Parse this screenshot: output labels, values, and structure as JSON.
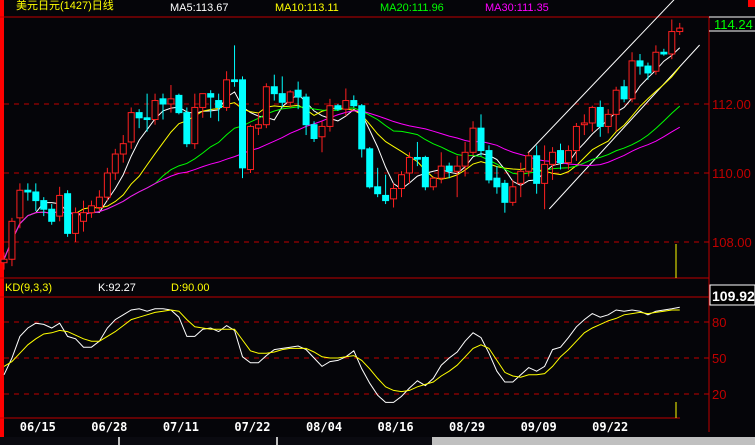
{
  "header": {
    "title": "美元日元(1427)日线",
    "ma5": "MA5:113.67",
    "ma10": "MA10:113.11",
    "ma20": "MA20:111.96",
    "ma30": "MA30:111.35"
  },
  "indicator": {
    "name": "KD(9,3,3)",
    "k": "K:92.27",
    "d": "D:90.00"
  },
  "right_axis": {
    "current_price": "114.24",
    "price_ticks": [
      "112.00",
      "110.00",
      "108.00"
    ],
    "cursor_value": "109.92",
    "kd_ticks": [
      "80",
      "50",
      "20"
    ]
  },
  "colors": {
    "up": "#ff2020",
    "down": "#00ffff",
    "ma5": "#ffffff",
    "ma10": "#ffff00",
    "ma20": "#00ff00",
    "ma30": "#ff00ff",
    "grid": "#c00000"
  },
  "chart_data": [
    {
      "type": "candlestick",
      "title": "美元日元(1427)日线",
      "x_tick_labels": [
        "06/15",
        "06/28",
        "07/11",
        "07/22",
        "08/04",
        "08/16",
        "08/29",
        "09/09",
        "09/22"
      ],
      "x_tick_index": [
        4,
        13,
        22,
        31,
        40,
        49,
        58,
        67,
        76
      ],
      "ylim": [
        107.0,
        114.9
      ],
      "y_ticks": [
        108,
        110,
        112
      ],
      "ohlc": [
        [
          107.4,
          107.7,
          107.2,
          107.5
        ],
        [
          107.5,
          108.7,
          107.3,
          108.6
        ],
        [
          108.7,
          109.7,
          108.4,
          109.5
        ],
        [
          109.5,
          109.7,
          109.2,
          109.45
        ],
        [
          109.45,
          109.7,
          108.9,
          109.2
        ],
        [
          109.2,
          109.3,
          108.75,
          108.95
        ],
        [
          108.95,
          109.1,
          108.5,
          108.6
        ],
        [
          108.75,
          109.6,
          108.6,
          109.35
        ],
        [
          109.4,
          109.5,
          108.15,
          108.25
        ],
        [
          108.25,
          109.0,
          108.0,
          108.85
        ],
        [
          108.6,
          109.2,
          108.3,
          108.85
        ],
        [
          108.85,
          109.2,
          108.7,
          109.05
        ],
        [
          109.0,
          109.5,
          108.9,
          109.3
        ],
        [
          109.3,
          110.15,
          109.2,
          110.0
        ],
        [
          110.0,
          110.7,
          109.8,
          110.55
        ],
        [
          110.55,
          111.1,
          110.3,
          110.85
        ],
        [
          110.9,
          111.9,
          110.7,
          111.75
        ],
        [
          111.75,
          111.85,
          111.3,
          111.6
        ],
        [
          111.6,
          112.3,
          111.2,
          111.55
        ],
        [
          111.55,
          112.3,
          111.4,
          112.1
        ],
        [
          112.15,
          112.3,
          111.55,
          112.0
        ],
        [
          112.0,
          112.55,
          111.75,
          112.15
        ],
        [
          112.25,
          112.3,
          111.7,
          111.75
        ],
        [
          111.75,
          111.9,
          110.75,
          110.85
        ],
        [
          110.85,
          112.3,
          110.7,
          111.9
        ],
        [
          111.9,
          112.3,
          111.6,
          112.3
        ],
        [
          112.3,
          112.4,
          111.6,
          112.2
        ],
        [
          112.1,
          112.3,
          111.5,
          111.9
        ],
        [
          111.9,
          112.95,
          111.8,
          112.7
        ],
        [
          112.7,
          113.7,
          112.5,
          112.65
        ],
        [
          112.7,
          112.8,
          109.85,
          110.15
        ],
        [
          110.1,
          111.4,
          110.0,
          111.35
        ],
        [
          111.3,
          111.75,
          111.1,
          111.4
        ],
        [
          111.4,
          112.6,
          111.3,
          112.5
        ],
        [
          112.5,
          112.85,
          112.1,
          112.3
        ],
        [
          112.3,
          112.8,
          111.9,
          112.05
        ],
        [
          112.05,
          112.4,
          111.9,
          112.35
        ],
        [
          112.4,
          112.65,
          111.85,
          112.2
        ],
        [
          112.2,
          112.3,
          111.1,
          111.4
        ],
        [
          111.4,
          111.5,
          110.9,
          111.0
        ],
        [
          111.05,
          111.5,
          110.6,
          111.35
        ],
        [
          111.35,
          112.15,
          111.2,
          111.95
        ],
        [
          111.95,
          112.0,
          111.8,
          111.85
        ],
        [
          111.85,
          112.45,
          111.65,
          112.1
        ],
        [
          112.1,
          112.25,
          111.9,
          111.95
        ],
        [
          111.95,
          112.0,
          110.45,
          110.7
        ],
        [
          110.7,
          110.75,
          109.55,
          109.6
        ],
        [
          109.6,
          110.15,
          109.3,
          109.4
        ],
        [
          109.35,
          109.95,
          109.1,
          109.2
        ],
        [
          109.25,
          109.7,
          109.0,
          109.55
        ],
        [
          109.55,
          110.05,
          109.3,
          109.95
        ],
        [
          110.0,
          110.6,
          109.7,
          110.45
        ],
        [
          110.45,
          110.9,
          110.2,
          110.4
        ],
        [
          110.45,
          110.5,
          109.5,
          109.6
        ],
        [
          109.6,
          109.9,
          109.5,
          109.85
        ],
        [
          109.85,
          110.6,
          109.7,
          110.2
        ],
        [
          110.2,
          110.3,
          109.85,
          110.05
        ],
        [
          110.05,
          110.5,
          109.3,
          110.2
        ],
        [
          110.2,
          110.9,
          109.9,
          110.6
        ],
        [
          110.6,
          111.5,
          110.5,
          111.3
        ],
        [
          111.3,
          111.7,
          110.5,
          110.65
        ],
        [
          110.65,
          110.8,
          109.7,
          109.8
        ],
        [
          109.85,
          110.2,
          109.4,
          109.6
        ],
        [
          109.7,
          109.8,
          108.85,
          109.15
        ],
        [
          109.15,
          109.8,
          109.05,
          109.6
        ],
        [
          109.7,
          110.3,
          109.3,
          110.05
        ],
        [
          110.05,
          110.6,
          109.9,
          110.5
        ],
        [
          110.5,
          110.8,
          109.4,
          109.7
        ],
        [
          109.7,
          110.8,
          108.95,
          110.25
        ],
        [
          110.25,
          110.75,
          109.8,
          110.6
        ],
        [
          110.65,
          110.85,
          110.1,
          110.3
        ],
        [
          110.3,
          110.8,
          110.1,
          110.65
        ],
        [
          110.65,
          111.45,
          110.35,
          111.35
        ],
        [
          111.4,
          111.7,
          111.1,
          111.45
        ],
        [
          111.45,
          111.95,
          111.2,
          111.9
        ],
        [
          111.9,
          112.1,
          111.05,
          111.35
        ],
        [
          111.35,
          111.85,
          111.15,
          111.7
        ],
        [
          111.7,
          112.5,
          111.2,
          112.4
        ],
        [
          112.5,
          112.7,
          112.05,
          112.15
        ],
        [
          112.15,
          113.5,
          112.05,
          113.25
        ],
        [
          113.25,
          113.45,
          112.85,
          113.1
        ],
        [
          113.1,
          113.2,
          112.7,
          112.9
        ],
        [
          112.95,
          113.7,
          112.85,
          113.5
        ],
        [
          113.5,
          113.6,
          113.4,
          113.45
        ],
        [
          113.45,
          114.45,
          113.3,
          114.1
        ],
        [
          114.1,
          114.35,
          114.0,
          114.2
        ]
      ],
      "moving_averages": [
        {
          "name": "MA5",
          "period": 5,
          "last": 113.67
        },
        {
          "name": "MA10",
          "period": 10,
          "last": 113.11
        },
        {
          "name": "MA20",
          "period": 20,
          "last": 111.96
        },
        {
          "name": "MA30",
          "period": 30,
          "last": 111.35
        }
      ],
      "trendlines": [
        {
          "name": "channel-upper",
          "from": [
            65.9,
            110.58
          ],
          "to": [
            87.5,
            115.8
          ]
        },
        {
          "name": "channel-lower",
          "from": [
            68.6,
            108.96
          ],
          "to": [
            87.5,
            113.71
          ]
        }
      ]
    },
    {
      "type": "line",
      "title": "KD(9,3,3)",
      "ylim": [
        0,
        100
      ],
      "y_ticks": [
        20,
        50,
        80
      ],
      "series": [
        {
          "name": "K",
          "values": [
            36,
            50,
            68,
            75,
            79,
            78,
            75,
            79,
            68,
            66,
            59,
            59,
            64,
            75,
            82,
            86,
            90,
            91,
            89,
            91,
            91,
            90,
            84,
            68,
            68,
            74,
            75,
            72,
            77,
            73,
            51,
            46,
            46,
            52,
            57,
            58,
            59,
            60,
            57,
            50,
            43,
            47,
            48,
            51,
            56,
            41,
            29,
            19,
            13,
            13,
            18,
            25,
            31,
            27,
            33,
            44,
            50,
            55,
            64,
            71,
            67,
            54,
            39,
            30,
            30,
            36,
            42,
            39,
            43,
            57,
            59,
            67,
            76,
            82,
            87,
            84,
            86,
            90,
            89,
            90,
            89,
            86,
            89,
            90,
            91,
            92.27
          ]
        },
        {
          "name": "D",
          "values": [
            43,
            47,
            54,
            61,
            66,
            70,
            71,
            73,
            72,
            69,
            66,
            64,
            64,
            68,
            72,
            77,
            82,
            84,
            86,
            88,
            89,
            90,
            89,
            82,
            76,
            75,
            74,
            74,
            74,
            74,
            65,
            56,
            54,
            54,
            55,
            57,
            58,
            58,
            58,
            55,
            51,
            50,
            50,
            51,
            52,
            48,
            41,
            33,
            26,
            23,
            22,
            23,
            26,
            28,
            30,
            35,
            39,
            44,
            51,
            58,
            61,
            58,
            48,
            38,
            35,
            34,
            36,
            36,
            37,
            43,
            51,
            57,
            64,
            71,
            75,
            78,
            81,
            83,
            86,
            87,
            88,
            87,
            88,
            89,
            90,
            90.0
          ]
        }
      ]
    }
  ]
}
